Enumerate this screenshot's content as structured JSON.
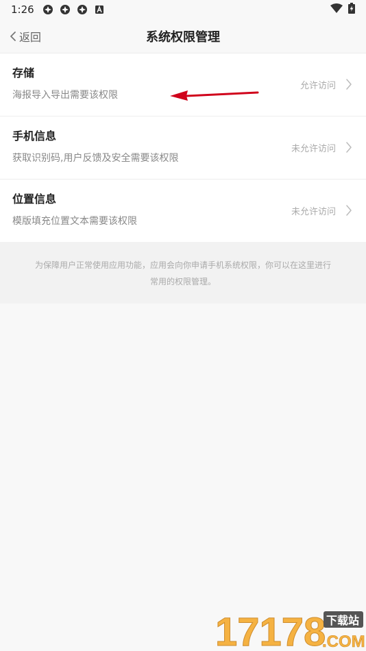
{
  "status_bar": {
    "time": "1:26"
  },
  "nav": {
    "back_label": "返回",
    "title": "系统权限管理"
  },
  "permissions": [
    {
      "title": "存储",
      "desc": "海报导入导出需要该权限",
      "status": "允许访问"
    },
    {
      "title": "手机信息",
      "desc": "获取识别码,用户反馈及安全需要该权限",
      "status": "未允许访问"
    },
    {
      "title": "位置信息",
      "desc": "模版填充位置文本需要该权限",
      "status": "未允许访问"
    }
  ],
  "note": {
    "line1": "为保障用户正常使用应用功能，应用会向你申请手机系统权限，你可以在这里进行",
    "line2": "常用的权限管理。"
  },
  "watermark": {
    "number": "17178",
    "site": "下载站",
    "domain": ".COM"
  },
  "colors": {
    "background": "#f8f8f8",
    "accent_arrow": "#d0021b",
    "watermark_orange": "#f5a623"
  }
}
